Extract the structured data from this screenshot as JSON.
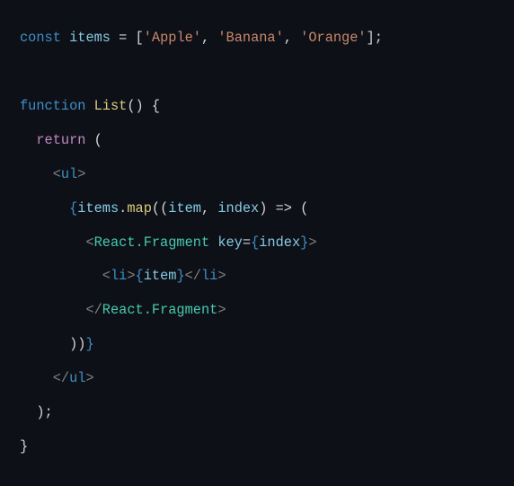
{
  "code": {
    "line1": {
      "kw_const": "const",
      "var_items": "items",
      "eq": " = ",
      "br_open": "[",
      "str1": "'Apple'",
      "str2": "'Banana'",
      "str3": "'Orange'",
      "br_close": "]",
      "end": ";"
    },
    "line3": {
      "kw_function": "function",
      "fn_name": "List",
      "parens": "()",
      "brace": " {"
    },
    "line4": {
      "indent": "  ",
      "kw_return": "return",
      "paren": " ("
    },
    "line5": {
      "indent": "    ",
      "lt": "<",
      "tag": "ul",
      "gt": ">"
    },
    "line6": {
      "indent": "      ",
      "brace": "{",
      "var1": "items",
      "dot": ".",
      "fn": "map",
      "open": "((",
      "var2": "item",
      "comma": ", ",
      "var3": "index",
      "arrow": ") => ("
    },
    "line7": {
      "indent": "        ",
      "lt": "<",
      "comp": "React.Fragment",
      "sp": " ",
      "attr": "key",
      "eq": "=",
      "br_open": "{",
      "var": "index",
      "br_close": "}",
      "gt": ">"
    },
    "line8": {
      "indent": "          ",
      "lt1": "<",
      "tag1": "li",
      "gt1": ">",
      "br_open": "{",
      "var": "item",
      "br_close": "}",
      "lt2": "</",
      "tag2": "li",
      "gt2": ">"
    },
    "line9": {
      "indent": "        ",
      "lt": "</",
      "comp": "React.Fragment",
      "gt": ">"
    },
    "line10": {
      "indent": "      ",
      "close": "))",
      "brace": "}"
    },
    "line11": {
      "indent": "    ",
      "lt": "</",
      "tag": "ul",
      "gt": ">"
    },
    "line12": {
      "indent": "  ",
      "close": ");"
    },
    "line13": {
      "close": "}"
    }
  }
}
